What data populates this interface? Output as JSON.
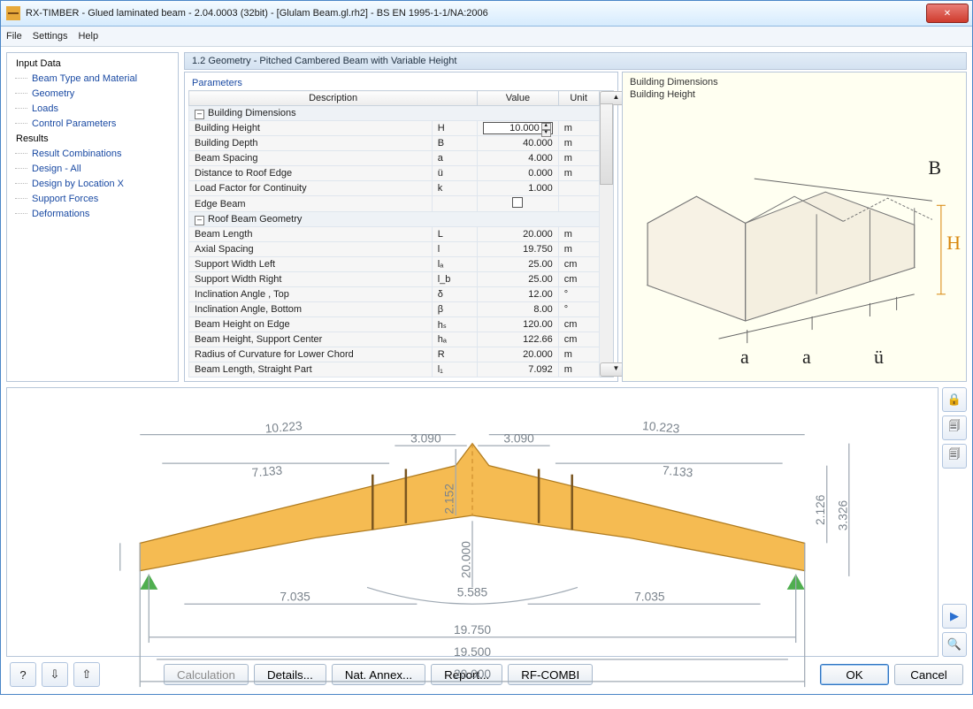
{
  "window": {
    "title": "RX-TIMBER - Glued laminated beam - 2.04.0003 (32bit) - [Glulam Beam.gl.rh2] - BS EN 1995-1-1/NA:2006",
    "close_label": "✕"
  },
  "menu": {
    "file": "File",
    "settings": "Settings",
    "help": "Help"
  },
  "nav": {
    "input_data": "Input Data",
    "beam_type": "Beam Type and Material",
    "geometry": "Geometry",
    "loads": "Loads",
    "control_params": "Control Parameters",
    "results": "Results",
    "result_comb": "Result Combinations",
    "design_all": "Design - All",
    "design_loc": "Design by Location X",
    "support_forces": "Support Forces",
    "deformations": "Deformations"
  },
  "panel_title": "1.2 Geometry  -  Pitched Cambered Beam with Variable Height",
  "param_label": "Parameters",
  "columns": {
    "desc": "Description",
    "value": "Value",
    "unit": "Unit"
  },
  "groups": {
    "building": "Building Dimensions",
    "roof": "Roof Beam Geometry"
  },
  "rows": {
    "r1": {
      "desc": "Building Height",
      "sym": "H",
      "val": "10.000",
      "unit": "m"
    },
    "r2": {
      "desc": "Building Depth",
      "sym": "B",
      "val": "40.000",
      "unit": "m"
    },
    "r3": {
      "desc": "Beam Spacing",
      "sym": "a",
      "val": "4.000",
      "unit": "m"
    },
    "r4": {
      "desc": "Distance to Roof Edge",
      "sym": "ü",
      "val": "0.000",
      "unit": "m"
    },
    "r5": {
      "desc": "Load Factor for Continuity",
      "sym": "k",
      "val": "1.000",
      "unit": ""
    },
    "r6": {
      "desc": "Edge Beam",
      "sym": "",
      "val": "",
      "unit": ""
    },
    "r7": {
      "desc": "Beam Length",
      "sym": "L",
      "val": "20.000",
      "unit": "m"
    },
    "r8": {
      "desc": "Axial Spacing",
      "sym": "l",
      "val": "19.750",
      "unit": "m"
    },
    "r9": {
      "desc": "Support Width Left",
      "sym": "lₐ",
      "val": "25.00",
      "unit": "cm"
    },
    "r10": {
      "desc": "Support Width Right",
      "sym": "l_b",
      "val": "25.00",
      "unit": "cm"
    },
    "r11": {
      "desc": "Inclination Angle , Top",
      "sym": "δ",
      "val": "12.00",
      "unit": "°"
    },
    "r12": {
      "desc": "Inclination Angle, Bottom",
      "sym": "β",
      "val": "8.00",
      "unit": "°"
    },
    "r13": {
      "desc": "Beam Height on Edge",
      "sym": "hₛ",
      "val": "120.00",
      "unit": "cm"
    },
    "r14": {
      "desc": "Beam Height, Support Center",
      "sym": "hₐ",
      "val": "122.66",
      "unit": "cm"
    },
    "r15": {
      "desc": "Radius of Curvature for Lower Chord",
      "sym": "R",
      "val": "20.000",
      "unit": "m"
    },
    "r16": {
      "desc": "Beam Length, Straight Part",
      "sym": "l₁",
      "val": "7.092",
      "unit": "m"
    }
  },
  "info": {
    "l1": "Building Dimensions",
    "l2": "Building Height"
  },
  "iso_labels": {
    "B": "B",
    "H": "H",
    "a": "a",
    "u": "ü"
  },
  "drawing": {
    "d1": "10.223",
    "d1b": "10.223",
    "d2": "3.090",
    "d2b": "3.090",
    "d3": "7.133",
    "d3b": "7.133",
    "d4": "2.152",
    "d5": "2.126",
    "d6": "3.326",
    "d7": "20.000",
    "d8": "5.585",
    "d9": "7.035",
    "d9b": "7.035",
    "d10": "19.750",
    "d11": "19.500",
    "d12": "20.000"
  },
  "buttons": {
    "calculation": "Calculation",
    "details": "Details...",
    "nat_annex": "Nat. Annex...",
    "report": "Report...",
    "rfcombi": "RF-COMBI",
    "ok": "OK",
    "cancel": "Cancel"
  },
  "tool_tips": {
    "lock": "🔒",
    "page1": "🗐",
    "page2": "🗐",
    "play": "▶",
    "search": "🔍"
  },
  "bottom_icons": {
    "help": "?",
    "tree1": "⇩",
    "tree2": "⇧"
  }
}
